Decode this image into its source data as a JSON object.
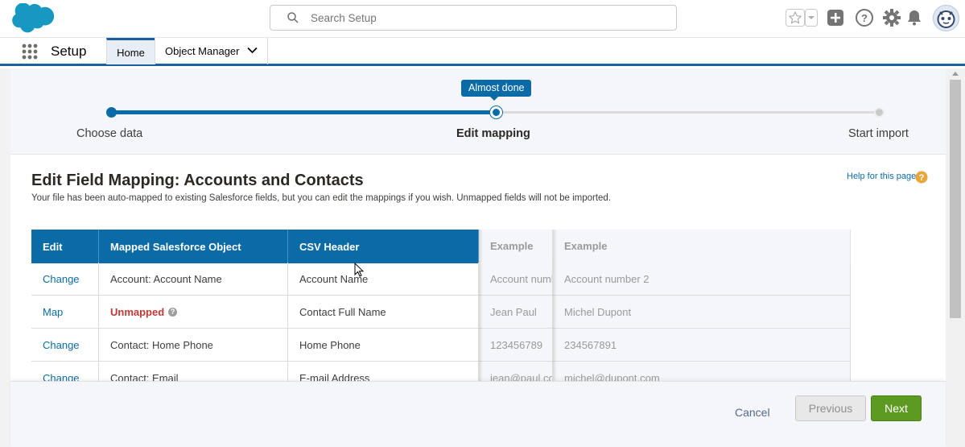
{
  "header": {
    "logo": "salesforce-cloud-logo",
    "search_placeholder": "Search Setup",
    "icons": [
      "favorites-star-icon",
      "favorites-dropdown-icon",
      "global-add-icon",
      "help-icon",
      "setup-gear-icon",
      "notifications-bell-icon",
      "user-avatar"
    ]
  },
  "app_nav": {
    "app_name": "Setup",
    "tabs": [
      {
        "label": "Home",
        "active": true
      },
      {
        "label": "Object Manager",
        "has_menu": true
      }
    ]
  },
  "progress": {
    "steps": [
      {
        "label": "Choose data",
        "state": "complete"
      },
      {
        "label": "Edit mapping",
        "state": "current"
      },
      {
        "label": "Start import",
        "state": "incomplete"
      }
    ],
    "tooltip": "Almost done",
    "fill_fraction": 0.5
  },
  "page": {
    "title": "Edit Field Mapping: Accounts and Contacts",
    "subtitle": "Your file has been auto-mapped to existing Salesforce fields, but you can edit the mappings if you wish. Unmapped fields will not be imported.",
    "help_link": "Help for this page"
  },
  "table": {
    "headers": [
      "Edit",
      "Mapped Salesforce Object",
      "CSV Header",
      "Example",
      "Example"
    ],
    "rows": [
      {
        "edit": "Change",
        "object": "Account: Account Name",
        "csv": "Account Name",
        "ex1": "Account numb",
        "ex2": "Account number 2"
      },
      {
        "edit": "Map",
        "object": "Unmapped",
        "csv": "Contact Full Name",
        "ex1": "Jean Paul",
        "ex2": "Michel Dupont",
        "unmapped": true
      },
      {
        "edit": "Change",
        "object": "Contact: Home Phone",
        "csv": "Home Phone",
        "ex1": "123456789",
        "ex2": "234567891"
      },
      {
        "edit": "Change",
        "object": "Contact: Email",
        "csv": "E-mail Address",
        "ex1": "jean@paul.co",
        "ex2": "michel@dupont.com"
      }
    ]
  },
  "footer": {
    "cancel": "Cancel",
    "previous": "Previous",
    "next": "Next"
  },
  "colors": {
    "brand_blue": "#0b6ba7",
    "nav_accent": "#1b5f9e",
    "next_green": "#5d9a22",
    "unmapped_red": "#c23934"
  }
}
